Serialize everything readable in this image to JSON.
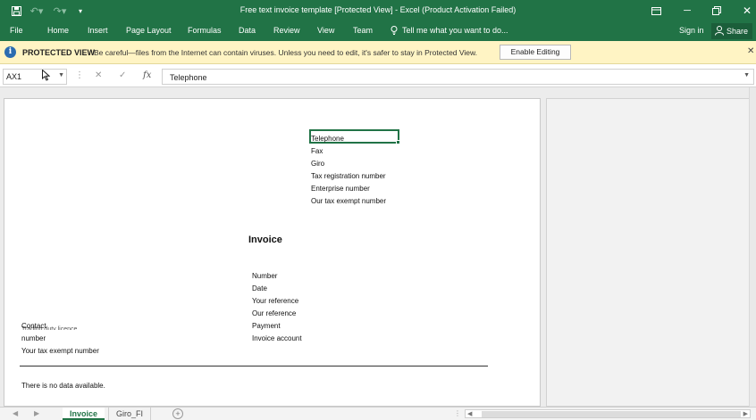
{
  "window": {
    "title": "Free text invoice template  [Protected View] - Excel (Product Activation Failed)",
    "quick_access": {
      "save_icon": "save-icon",
      "undo_icon": "undo-icon",
      "redo_icon": "redo-icon",
      "customize_icon": "customize-icon"
    },
    "controls": {
      "ribbon_display_icon": "ribbon-display-icon",
      "restore_icon": "restore-icon",
      "close_icon": "close-icon"
    }
  },
  "ribbon": {
    "tabs": [
      "File",
      "Home",
      "Insert",
      "Page Layout",
      "Formulas",
      "Data",
      "Review",
      "View",
      "Team"
    ],
    "tell_me": "Tell me what you want to do...",
    "sign_in": "Sign in",
    "share": "Share"
  },
  "protected_view": {
    "label": "PROTECTED VIEW",
    "message": "Be careful—files from the Internet can contain viruses. Unless you need to edit, it's safer to stay in Protected View.",
    "button": "Enable Editing"
  },
  "formula_bar": {
    "name_box": "AX1",
    "fx": "fx",
    "content": "Telephone"
  },
  "sheet": {
    "company_info": [
      "Telephone",
      "Fax",
      "Giro",
      "Tax registration number",
      "Enterprise number",
      "Our tax exempt number"
    ],
    "invoice_title": "Invoice",
    "invoice_fields": [
      "Number",
      "Date",
      "Your reference",
      "Our reference",
      "Payment",
      "Invoice account"
    ],
    "contact": "Contact",
    "trading_licence_partial": "Trading duty licence",
    "number": "number",
    "your_tax_exempt": "Your tax exempt number",
    "no_data": "There is no data available."
  },
  "sheet_tabs": [
    "Invoice",
    "Giro_FI"
  ],
  "active_tab": "Invoice"
}
